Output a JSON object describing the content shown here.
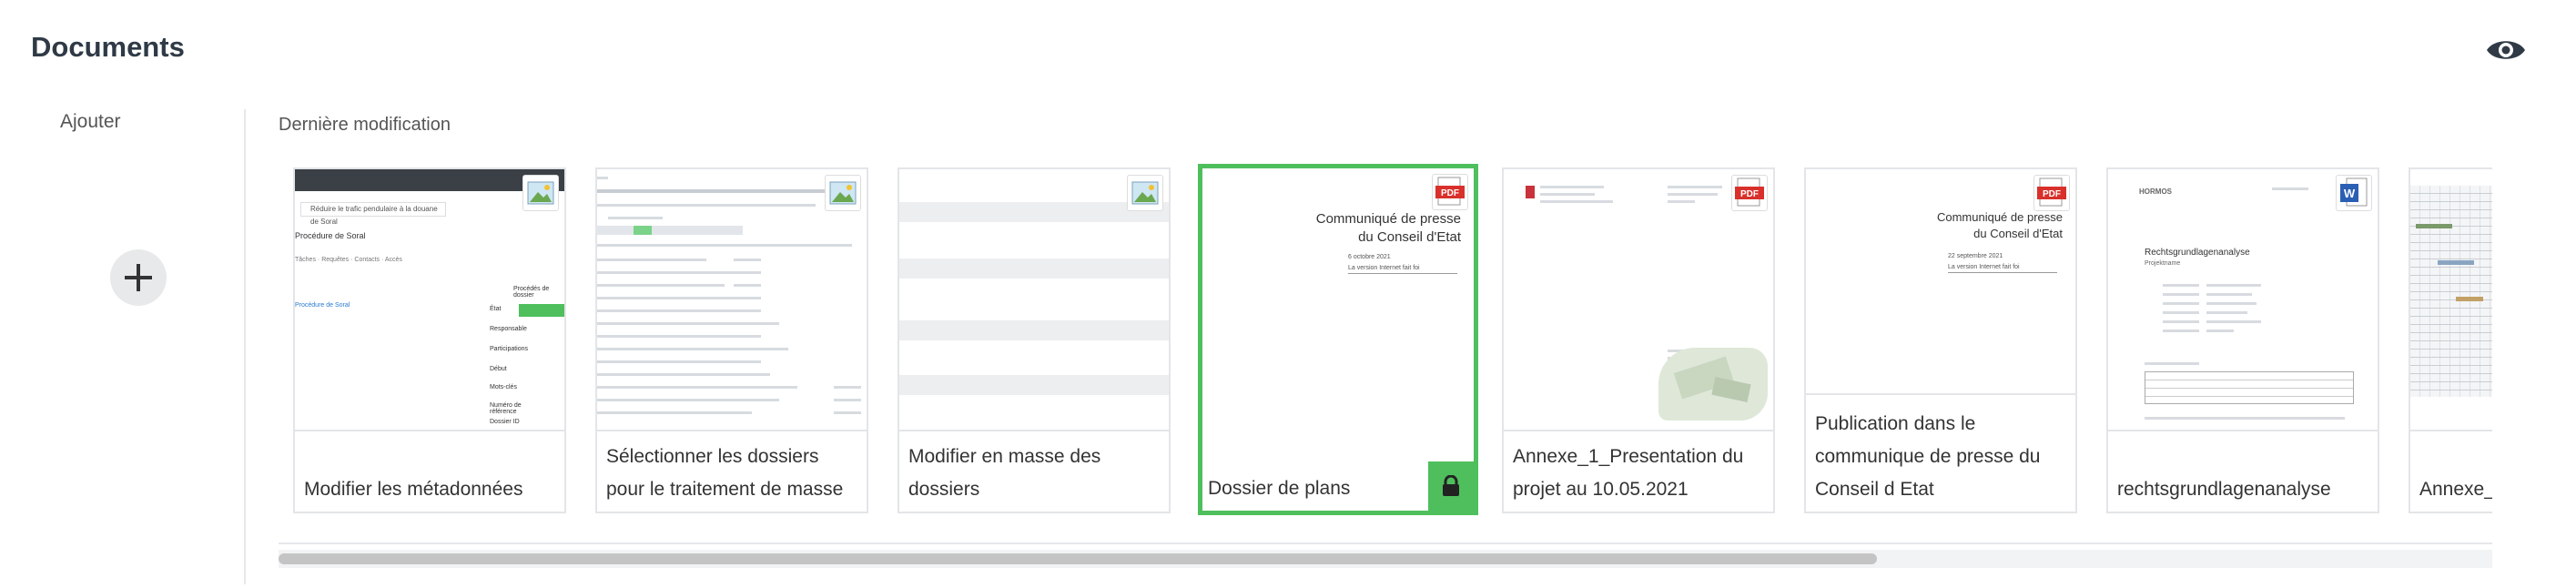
{
  "header": {
    "title": "Documents",
    "visibility_icon": "eye-icon"
  },
  "sidebar": {
    "add_label": "Ajouter",
    "add_icon": "plus-icon"
  },
  "section": {
    "label": "Dernière modification"
  },
  "documents": [
    {
      "title": "Modifier les métadonnées",
      "type": "image",
      "selected": false,
      "thumb_text": [
        "Réduire le trafic pendulaire à la douane de Soral",
        "Procédure de Soral",
        "Tâches",
        "Requêtes",
        "Contacts",
        "Accès",
        "Procédés de dossier",
        "État",
        "Responsable",
        "Participations",
        "Début",
        "Mots-clés",
        "Numéro de référence",
        "Dossier ID"
      ]
    },
    {
      "title": "Sélectionner les dossiers pour le traitement de masse",
      "type": "image",
      "selected": false
    },
    {
      "title": "Modifier en masse des dossiers",
      "type": "image",
      "selected": false
    },
    {
      "title": "Dossier de plans",
      "type": "pdf",
      "selected": true,
      "locked": true,
      "thumb_text": [
        "Communiqué de presse",
        "du Conseil d'Etat",
        "6 octobre 2021",
        "La version Internet fait foi"
      ]
    },
    {
      "title": "Annexe_1_Presentation du projet au 10.05.2021",
      "type": "pdf",
      "selected": false
    },
    {
      "title": "Publication dans le communique de presse du Conseil d Etat",
      "type": "pdf",
      "selected": false,
      "thumb_text": [
        "Communiqué de presse",
        "du Conseil d'Etat",
        "22 septembre 2021",
        "La version Internet fait foi"
      ]
    },
    {
      "title": "rechtsgrundlagenanalyse",
      "type": "word",
      "selected": false,
      "thumb_text": [
        "HORMOS",
        "Rechtsgrundlagenanalyse",
        "Projektname"
      ]
    },
    {
      "title": "Annexe_ vaux au",
      "type": "image",
      "selected": false
    }
  ],
  "colors": {
    "accent": "#4fbf5d",
    "pdf": "#d9302b",
    "word": "#2b5fb4"
  }
}
